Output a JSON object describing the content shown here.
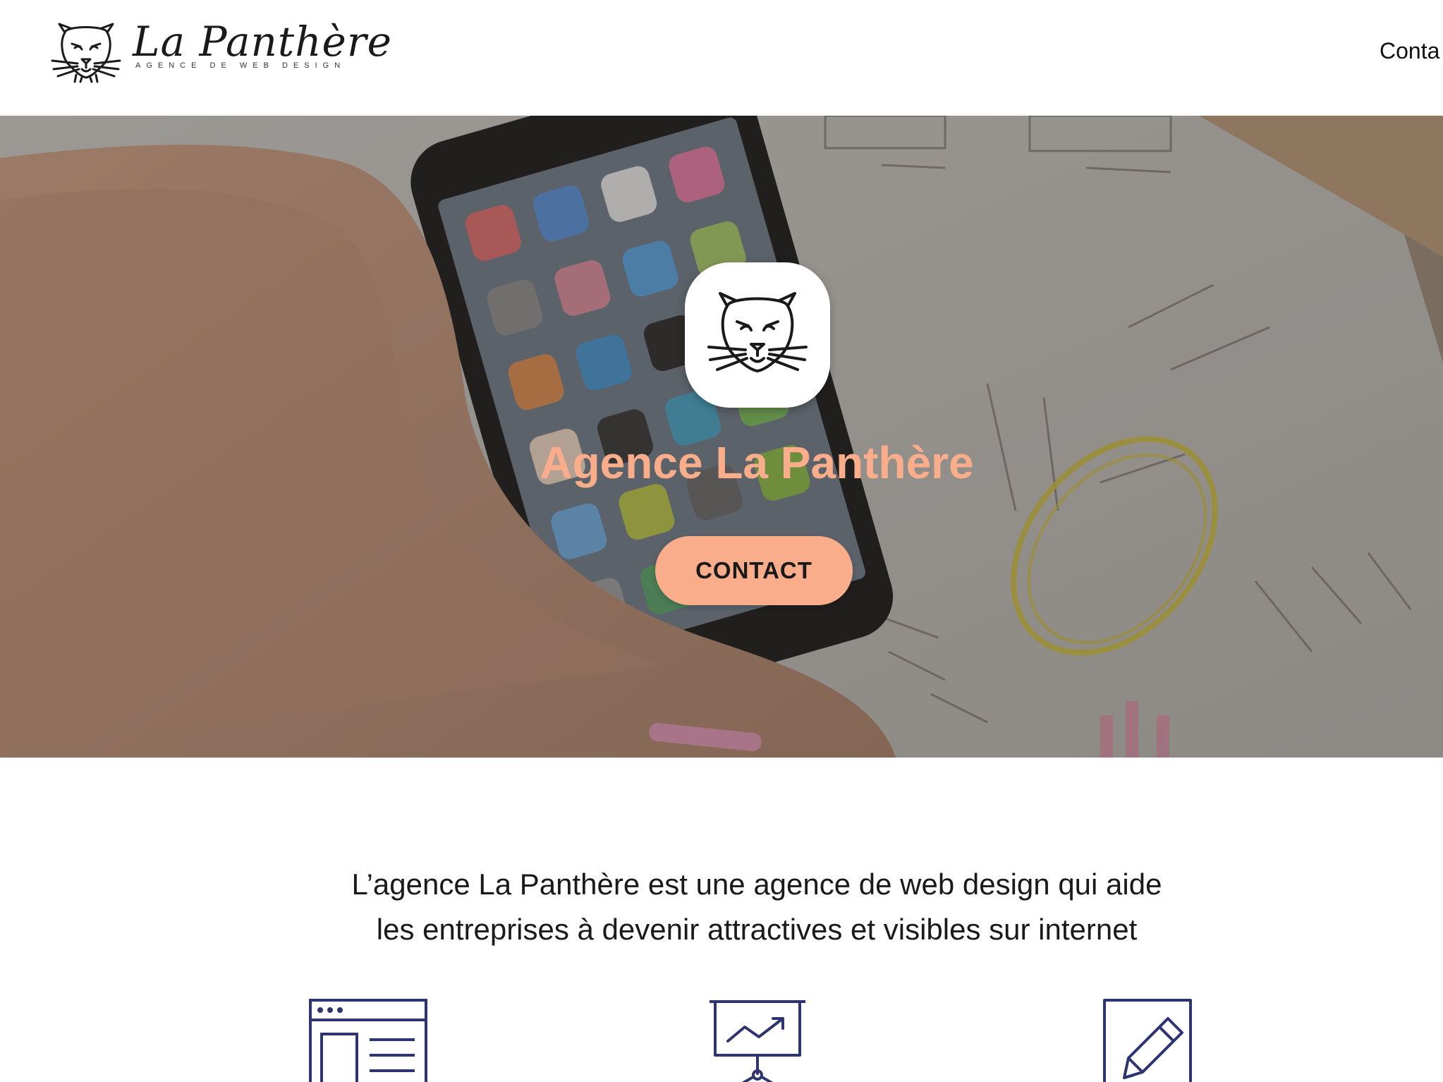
{
  "header": {
    "logo": {
      "name": "La Panthère",
      "tagline": "AGENCE DE WEB DESIGN",
      "icon": "panther-icon"
    },
    "nav": {
      "contact_label": "Conta"
    }
  },
  "hero": {
    "badge_icon": "panther-icon",
    "title": "Agence La Panthère",
    "cta_label": "CONTACT",
    "colors": {
      "accent": "#f9ad8a",
      "overlay": "#28242247"
    }
  },
  "intro": {
    "line1": "L’agence La Panthère est une agence de web design qui aide",
    "line2": "les entreprises à devenir attractives et visibles sur internet"
  },
  "services": {
    "icons": [
      "website-layout-icon",
      "presentation-chart-icon",
      "pencil-edit-icon"
    ],
    "icon_color": "#2e3470"
  }
}
